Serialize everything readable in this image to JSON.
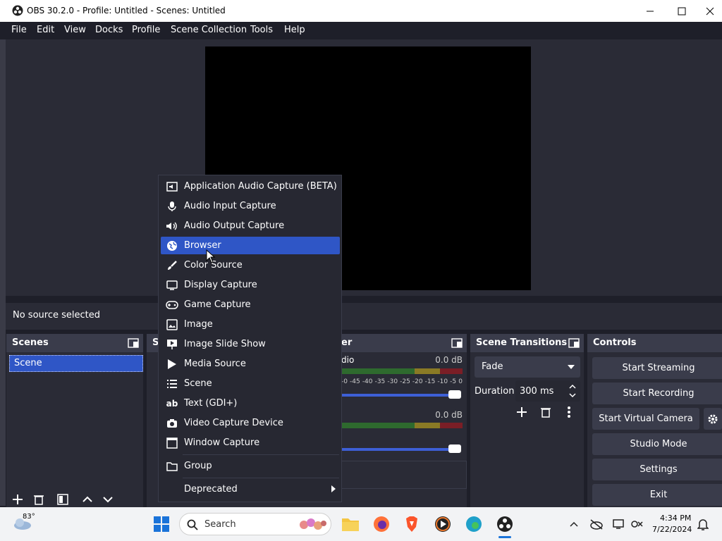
{
  "window": {
    "title": "OBS 30.2.0 - Profile: Untitled - Scenes: Untitled"
  },
  "menubar": [
    "File",
    "Edit",
    "View",
    "Docks",
    "Profile",
    "Scene Collection",
    "Tools",
    "Help"
  ],
  "status": {
    "no_source": "No source selected"
  },
  "scenes_dock": {
    "title": "Scenes",
    "items": [
      "Scene"
    ]
  },
  "sources_dock": {
    "title_partial": "S"
  },
  "mixer_dock": {
    "title_partial": "er",
    "channels": [
      {
        "name_partial": "dio",
        "level": "0.0 dB"
      },
      {
        "name_partial": "",
        "level": "0.0 dB"
      }
    ],
    "scale": [
      "-0",
      "-45",
      "-40",
      "-35",
      "-30",
      "-25",
      "-20",
      "-15",
      "-10",
      "-5",
      "0"
    ]
  },
  "transitions_dock": {
    "title": "Scene Transitions",
    "transition": "Fade",
    "duration_label": "Duration",
    "duration_value": "300 ms"
  },
  "controls_dock": {
    "title": "Controls",
    "buttons": [
      "Start Streaming",
      "Start Recording",
      "Start Virtual Camera",
      "Studio Mode",
      "Settings",
      "Exit"
    ]
  },
  "context_menu": {
    "items": [
      {
        "label": "Application Audio Capture (BETA)",
        "icon": "app-audio-icon"
      },
      {
        "label": "Audio Input Capture",
        "icon": "microphone-icon"
      },
      {
        "label": "Audio Output Capture",
        "icon": "speaker-icon"
      },
      {
        "label": "Browser",
        "icon": "globe-icon",
        "highlighted": true
      },
      {
        "label": "Color Source",
        "icon": "brush-icon"
      },
      {
        "label": "Display Capture",
        "icon": "monitor-icon"
      },
      {
        "label": "Game Capture",
        "icon": "gamepad-icon"
      },
      {
        "label": "Image",
        "icon": "image-icon"
      },
      {
        "label": "Image Slide Show",
        "icon": "slideshow-icon"
      },
      {
        "label": "Media Source",
        "icon": "play-icon"
      },
      {
        "label": "Scene",
        "icon": "list-icon"
      },
      {
        "label": "Text (GDI+)",
        "icon": "text-icon"
      },
      {
        "label": "Video Capture Device",
        "icon": "camera-icon"
      },
      {
        "label": "Window Capture",
        "icon": "window-icon"
      }
    ],
    "group": "Group",
    "deprecated": "Deprecated"
  },
  "taskbar": {
    "weather": "83°",
    "search_placeholder": "Search",
    "time": "4:34 PM",
    "date": "7/22/2024"
  },
  "colors": {
    "highlight": "#2f56c6",
    "panel": "#2a2b36",
    "dock_header": "#3a3c4b",
    "button": "#3a3c4b"
  }
}
